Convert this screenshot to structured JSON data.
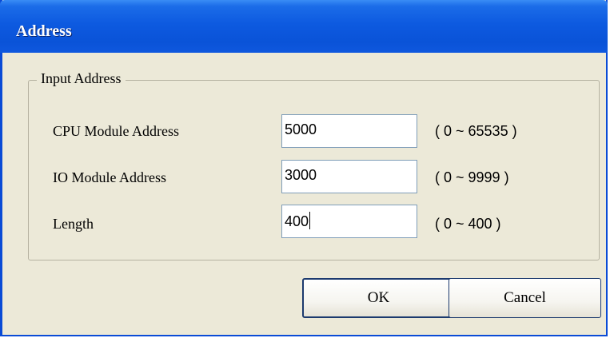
{
  "window": {
    "title": "Address"
  },
  "group": {
    "legend": "Input Address",
    "rows": [
      {
        "label": "CPU Module Address",
        "value": "5000",
        "range": "( 0 ~ 65535 )"
      },
      {
        "label": "IO Module Address",
        "value": "3000",
        "range": "( 0 ~ 9999 )"
      },
      {
        "label": "Length",
        "value": "400",
        "range": "( 0 ~ 400 )"
      }
    ]
  },
  "buttons": {
    "ok": "OK",
    "cancel": "Cancel"
  },
  "colors": {
    "titlebar": "#0a53d8",
    "dialog_bg": "#ece9d8",
    "field_border": "#7f9db9"
  }
}
